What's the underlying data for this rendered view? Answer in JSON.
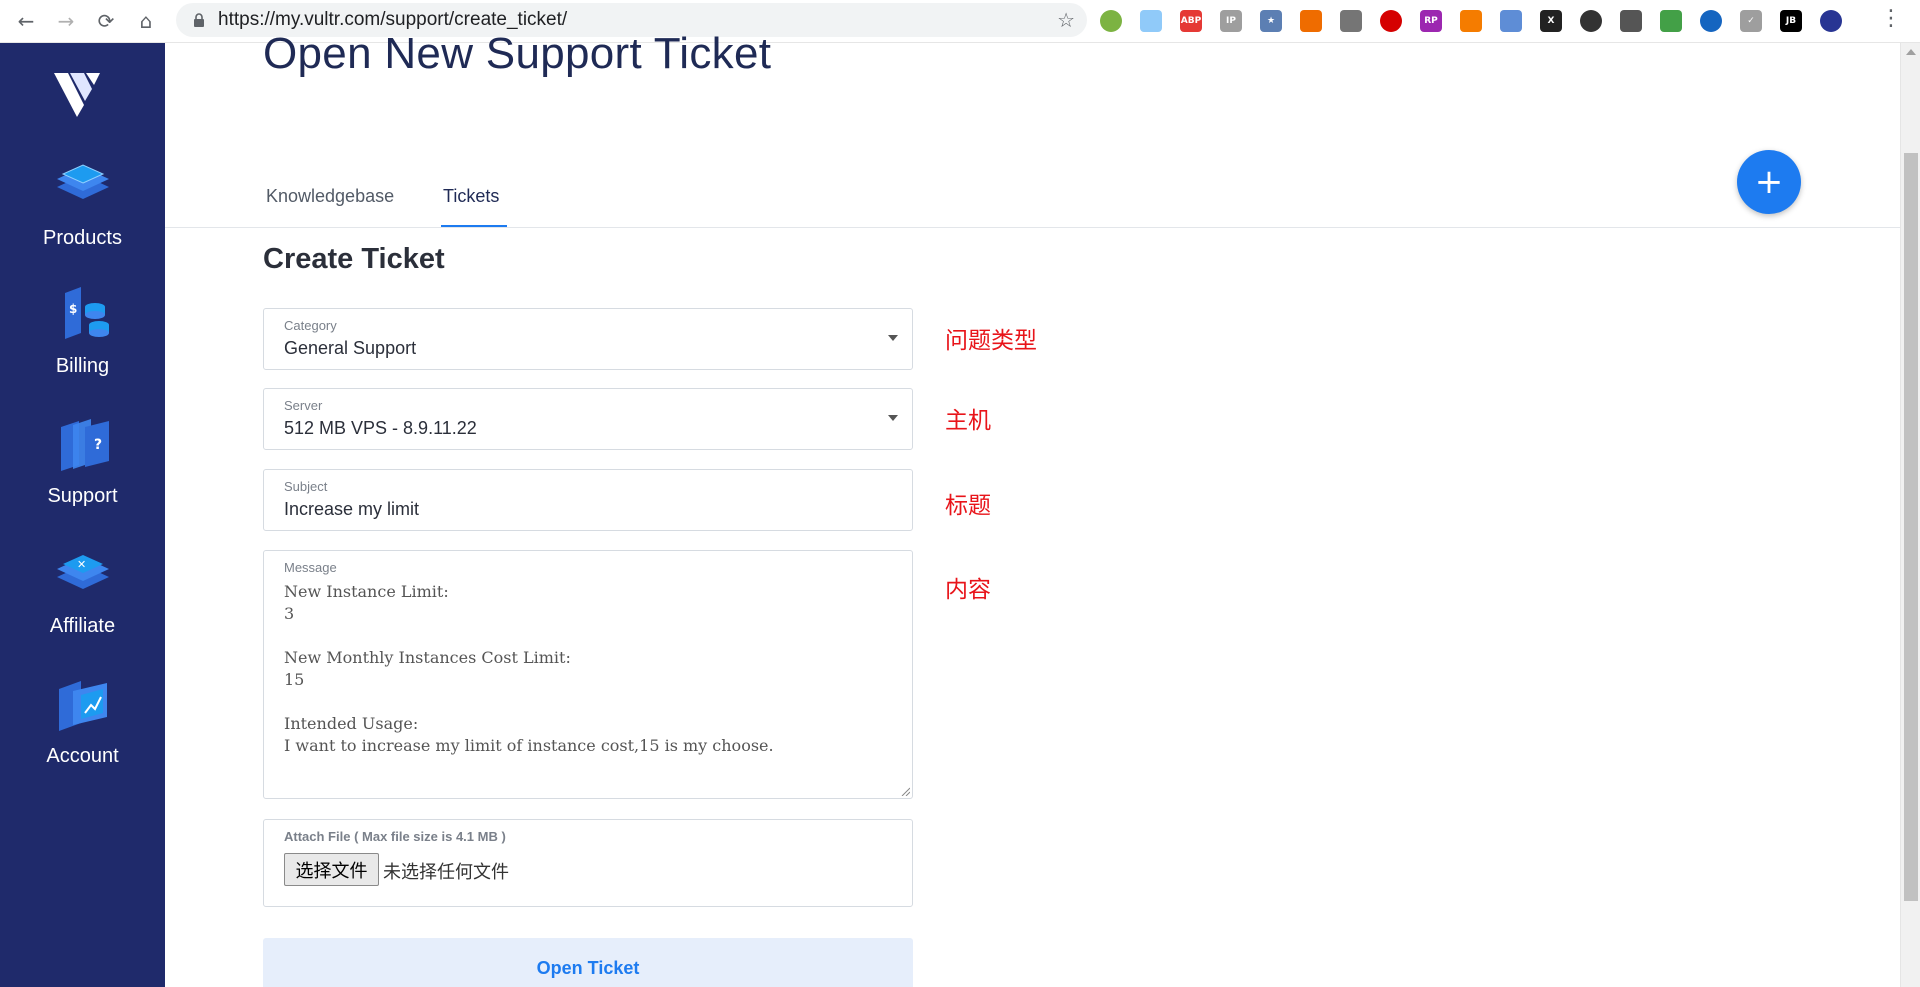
{
  "browser": {
    "url": "https://my.vultr.com/support/create_ticket/",
    "back_icon": "arrow-left",
    "forward_icon": "arrow-right",
    "reload_icon": "reload",
    "home_icon": "home",
    "bookmark_icon": "star",
    "menu_icon": "vertical-dots",
    "extensions": [
      {
        "name": "green-circle-ext",
        "color": "#7cb342",
        "text": ""
      },
      {
        "name": "cloud-ext",
        "color": "#90caf9",
        "text": ""
      },
      {
        "name": "adblock-plus-ext",
        "color": "#e53935",
        "text": "ABP"
      },
      {
        "name": "ip-ext",
        "color": "#9e9e9e",
        "text": "IP"
      },
      {
        "name": "star-box-ext",
        "color": "#5c7fb3",
        "text": "★"
      },
      {
        "name": "fox-ext",
        "color": "#ef6c00",
        "text": ""
      },
      {
        "name": "parachute-ext",
        "color": "#757575",
        "text": ""
      },
      {
        "name": "red-circle-ext",
        "color": "#d50000",
        "text": ""
      },
      {
        "name": "rp-ext",
        "color": "#9c27b0",
        "text": "RP"
      },
      {
        "name": "weibo-ext",
        "color": "#f57c00",
        "text": ""
      },
      {
        "name": "blue-oval-ext",
        "color": "#5e8dd6",
        "text": ""
      },
      {
        "name": "x-box-ext",
        "color": "#222222",
        "text": "X"
      },
      {
        "name": "aperture-ext",
        "color": "#333333",
        "text": ""
      },
      {
        "name": "cat-ext",
        "color": "#555555",
        "text": ""
      },
      {
        "name": "green-b-ext",
        "color": "#43a047",
        "text": ""
      },
      {
        "name": "globe-ext",
        "color": "#1565c0",
        "text": ""
      },
      {
        "name": "check-ext",
        "color": "#9e9e9e",
        "text": "✓"
      },
      {
        "name": "jb-ext",
        "color": "#000000",
        "text": "JB"
      },
      {
        "name": "profile-avatar",
        "color": "#283593",
        "text": ""
      }
    ]
  },
  "sidebar": {
    "items": [
      {
        "label": "Products",
        "icon": "products-stack-icon"
      },
      {
        "label": "Billing",
        "icon": "billing-icon"
      },
      {
        "label": "Support",
        "icon": "support-icon"
      },
      {
        "label": "Affiliate",
        "icon": "affiliate-icon"
      },
      {
        "label": "Account",
        "icon": "account-icon"
      }
    ]
  },
  "page": {
    "title": "Open New Support Ticket",
    "tabs": [
      {
        "label": "Knowledgebase",
        "active": false
      },
      {
        "label": "Tickets",
        "active": true
      }
    ],
    "fab_icon": "plus"
  },
  "form": {
    "title": "Create Ticket",
    "category": {
      "label": "Category",
      "value": "General Support"
    },
    "server": {
      "label": "Server",
      "value": "512 MB VPS - 8.9.11.22"
    },
    "subject": {
      "label": "Subject",
      "value": "Increase my limit"
    },
    "message": {
      "label": "Message",
      "value": "New Instance Limit:\n3\n\nNew Monthly Instances Cost Limit:\n15\n\nIntended Usage:\nI want to increase my limit of instance cost,15 is my choose."
    },
    "attach": {
      "label": "Attach File ( Max file size is 4.1 MB )",
      "button": "选择文件",
      "no_file": "未选择任何文件"
    },
    "submit": "Open Ticket"
  },
  "annotations": {
    "category": "问题类型",
    "server": "主机",
    "subject": "标题",
    "message": "内容"
  },
  "colors": {
    "sidebar_bg": "#1f2a6b",
    "accent": "#1d7bf0",
    "annotation": "#e8141a"
  }
}
